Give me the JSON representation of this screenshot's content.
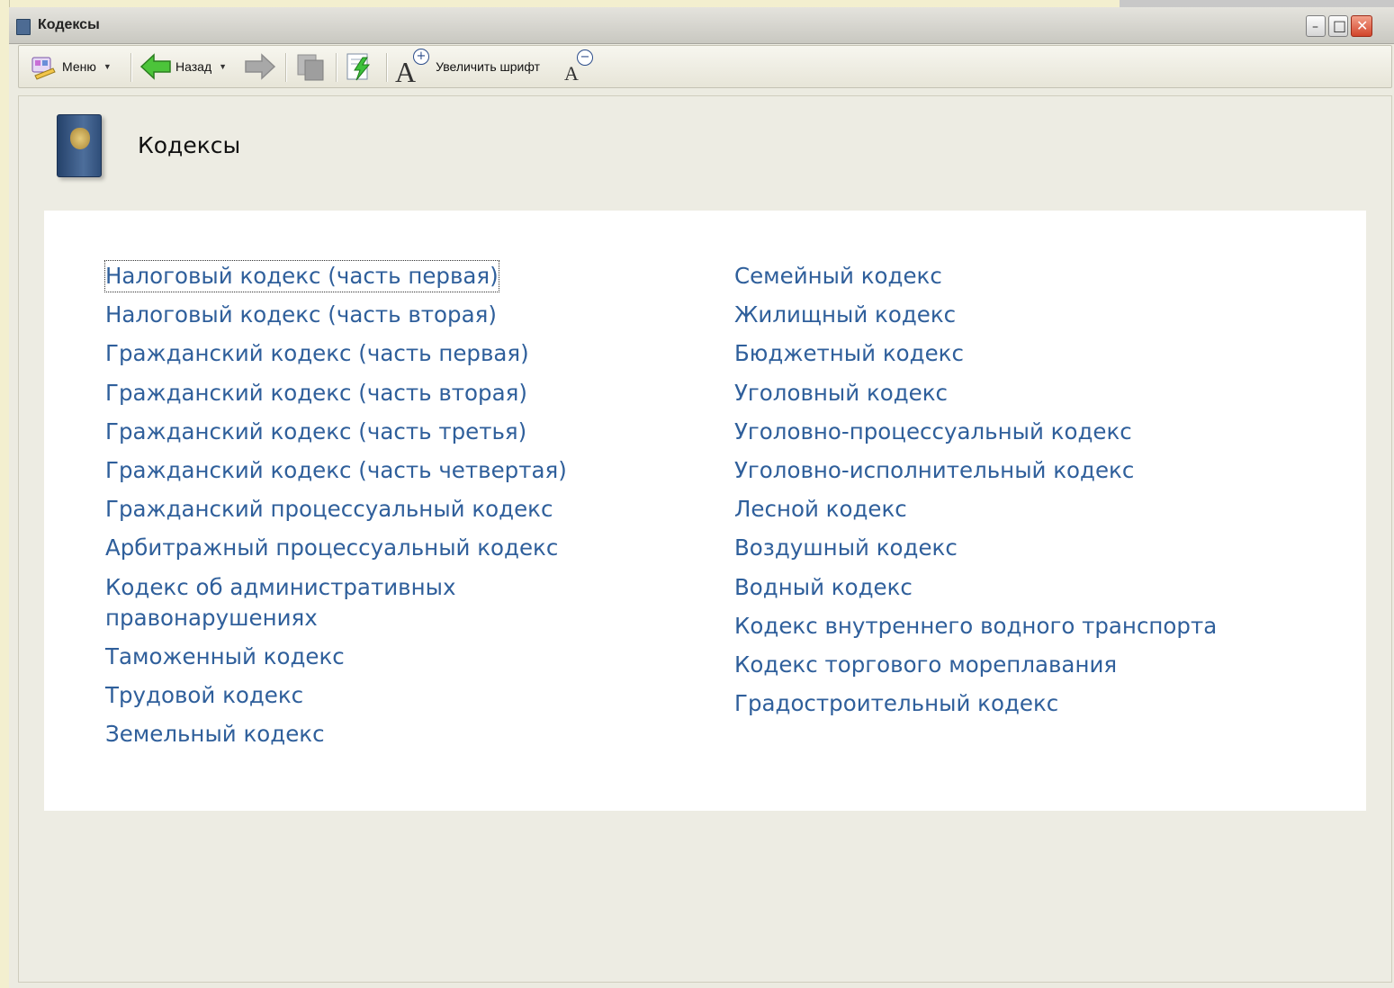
{
  "window": {
    "title": "Кодексы",
    "controls": {
      "minimize": "–",
      "maximize": "□",
      "close": "✕"
    }
  },
  "toolbar": {
    "menu_label": "Меню",
    "back_label": "Назад",
    "increase_font_label": "Увеличить шрифт",
    "font_glyph": "A",
    "plus_glyph": "+",
    "minus_glyph": "−"
  },
  "page": {
    "title": "Кодексы"
  },
  "codes": {
    "left": [
      "Налоговый кодекс (часть первая)",
      "Налоговый кодекс (часть вторая)",
      "Гражданский кодекс (часть первая)",
      "Гражданский кодекс (часть вторая)",
      "Гражданский кодекс (часть третья)",
      "Гражданский кодекс (часть четвертая)",
      "Гражданский процессуальный кодекс",
      "Арбитражный процессуальный кодекс",
      "Кодекс об административных правонарушениях",
      "Таможенный кодекс",
      "Трудовой кодекс",
      "Земельный кодекс"
    ],
    "right": [
      "Семейный кодекс",
      "Жилищный кодекс",
      "Бюджетный кодекс",
      "Уголовный кодекс",
      "Уголовно-процессуальный кодекс",
      "Уголовно-исполнительный кодекс",
      "Лесной кодекс",
      "Воздушный кодекс",
      "Водный кодекс",
      "Кодекс внутреннего водного транспорта",
      "Кодекс торгового мореплавания",
      "Градостроительный кодекс"
    ]
  },
  "colors": {
    "link": "#2f5f9b",
    "window_bg": "#ecebe1",
    "panel_bg": "#ffffff"
  }
}
